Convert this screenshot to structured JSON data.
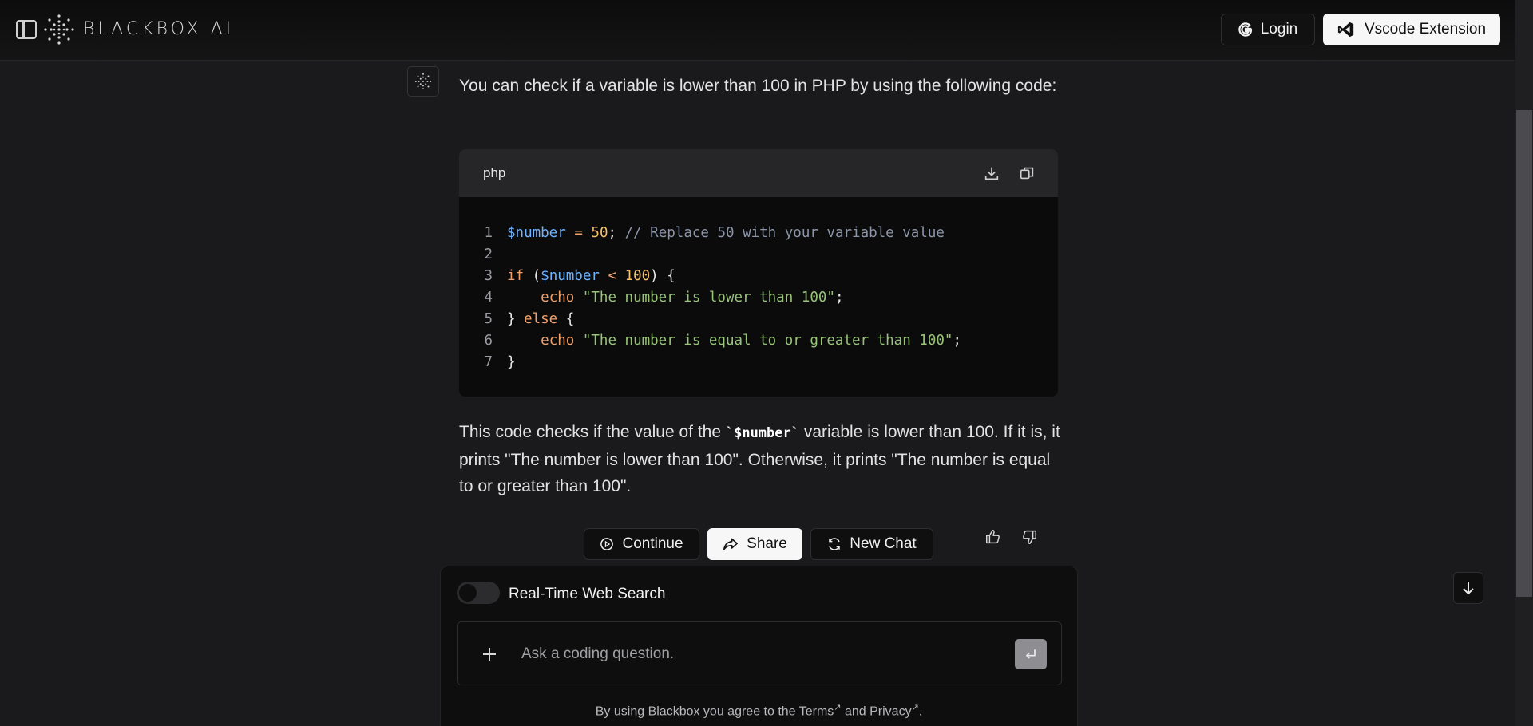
{
  "header": {
    "brand": "BLACKBOX AI",
    "login_label": "Login",
    "vscode_label": "Vscode Extension"
  },
  "message": {
    "intro": "You can check if a variable is lower than 100 in PHP by using the following code:",
    "code_language": "php",
    "code_lines": [
      "$number = 50; // Replace 50 with your variable value",
      "",
      "if ($number < 100) {",
      "    echo \"The number is lower than 100\";",
      "} else {",
      "    echo \"The number is equal to or greater than 100\";",
      "}"
    ],
    "explain_before": "This code checks if the value of the ",
    "explain_code": "`$number`",
    "explain_after": " variable is lower than 100. If it is, it prints \"The number is lower than 100\". Otherwise, it prints \"The number is equal to or greater than 100\"."
  },
  "actions": {
    "continue_label": "Continue",
    "share_label": "Share",
    "new_chat_label": "New Chat"
  },
  "composer": {
    "web_search_label": "Real-Time Web Search",
    "web_search_enabled": false,
    "input_value": "",
    "input_placeholder": "Ask a coding question.",
    "terms_prefix": "By using Blackbox you agree to the ",
    "terms_link": "Terms",
    "terms_middle": " and ",
    "privacy_link": "Privacy",
    "terms_suffix": "."
  },
  "colors": {
    "background": "#1a1a1c",
    "code_variable": "#6fb3ff",
    "code_keyword": "#f0a16b",
    "code_string": "#98c379",
    "code_number": "#f5c26b",
    "code_comment": "#8b95a7"
  },
  "icons": {
    "sidebar": "sidebar-toggle-icon",
    "download": "download-icon",
    "copy": "copy-icon",
    "send": "enter-icon",
    "scroll": "arrow-down-icon"
  }
}
